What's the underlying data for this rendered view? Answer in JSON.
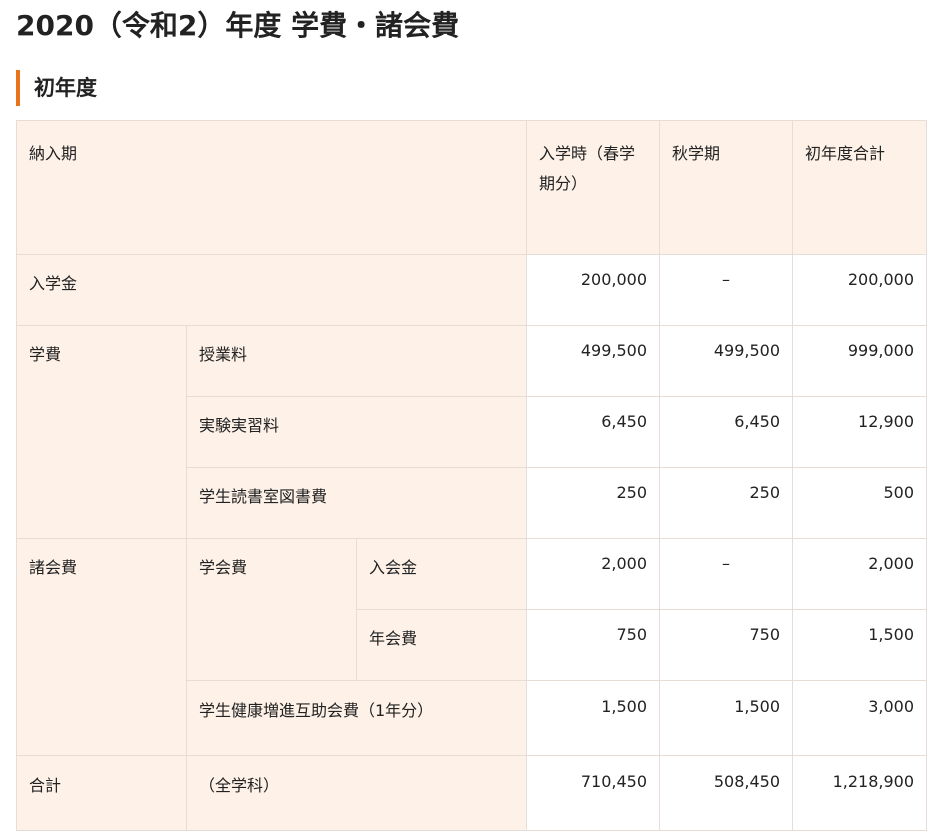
{
  "page_title": "2020（令和2）年度 学費・諸会費",
  "section_heading": "初年度",
  "table": {
    "header": {
      "period": "納入期",
      "col_spring": "入学時（春学期分）",
      "col_autumn": "秋学期",
      "col_total": "初年度合計"
    },
    "rows": {
      "admission": {
        "label": "入学金",
        "spring": "200,000",
        "autumn": "–",
        "total": "200,000"
      },
      "tuition": {
        "group": "学費",
        "lesson": {
          "label": "授業料",
          "spring": "499,500",
          "autumn": "499,500",
          "total": "999,000"
        },
        "lab": {
          "label": "実験実習料",
          "spring": "6,450",
          "autumn": "6,450",
          "total": "12,900"
        },
        "reading": {
          "label": "学生読書室図書費",
          "spring": "250",
          "autumn": "250",
          "total": "500"
        }
      },
      "fees": {
        "group": "諸会費",
        "society": {
          "label": "学会費",
          "entry": {
            "label": "入会金",
            "spring": "2,000",
            "autumn": "–",
            "total": "2,000"
          },
          "annual": {
            "label": "年会費",
            "spring": "750",
            "autumn": "750",
            "total": "1,500"
          }
        },
        "health": {
          "label": "学生健康増進互助会費（1年分）",
          "spring": "1,500",
          "autumn": "1,500",
          "total": "3,000"
        }
      },
      "total": {
        "label": "合計",
        "note": "（全学科）",
        "spring": "710,450",
        "autumn": "508,450",
        "total": "1,218,900"
      }
    }
  }
}
